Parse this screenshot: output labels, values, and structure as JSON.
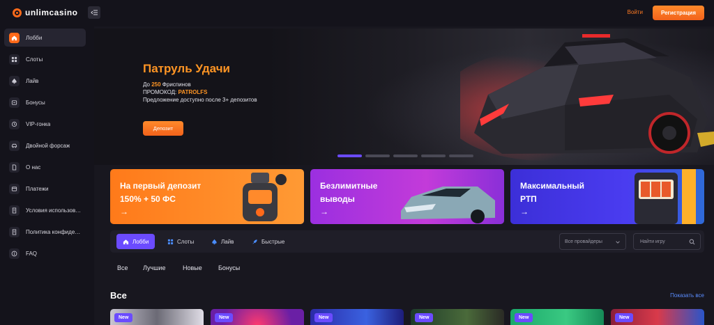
{
  "brand": {
    "name": "unlimcasino"
  },
  "header": {
    "login_label": "Войти",
    "register_label": "Регистрация"
  },
  "sidebar": {
    "items": [
      {
        "label": "Лобби",
        "icon": "home-icon"
      },
      {
        "label": "Слоты",
        "icon": "slots-grid-icon"
      },
      {
        "label": "Лайв",
        "icon": "live-spade-icon"
      },
      {
        "label": "Бонусы",
        "icon": "bonus-icon"
      },
      {
        "label": "VIP-гонка",
        "icon": "vip-race-icon"
      },
      {
        "label": "Двойной форсаж",
        "icon": "car-icon"
      },
      {
        "label": "О нас",
        "icon": "about-document-icon"
      },
      {
        "label": "Платежи",
        "icon": "payments-icon"
      },
      {
        "label": "Условия использова...",
        "icon": "terms-document-icon"
      },
      {
        "label": "Политика конфиден...",
        "icon": "privacy-document-icon"
      },
      {
        "label": "FAQ",
        "icon": "info-icon"
      }
    ]
  },
  "hero": {
    "title": "Патруль Удачи",
    "line1_prefix": "До",
    "line1_highlight": "250",
    "line1_suffix": "Фриспинов",
    "line2_prefix": "ПРОМОКОД:",
    "line2_highlight": "PATROLFS",
    "line3": "Предложение доступно после 3+ депозитов",
    "button_label": "Депозит",
    "slide_count": 5,
    "active_slide": 1
  },
  "promos": [
    {
      "title": "На первый депозит\n150% + 50 ФС",
      "arrow": "→"
    },
    {
      "title": "Безлимитные\nвыводы",
      "arrow": "→"
    },
    {
      "title": "Максимальный\nРТП",
      "arrow": "→"
    }
  ],
  "game_tabs": {
    "tabs": [
      {
        "label": "Лобби",
        "icon": "home-icon"
      },
      {
        "label": "Слоты",
        "icon": "slots-grid-icon"
      },
      {
        "label": "Лайв",
        "icon": "live-spade-icon"
      },
      {
        "label": "Быстрые",
        "icon": "rocket-icon"
      }
    ],
    "provider_placeholder": "Все провайдеры",
    "search_placeholder": "Найти игру"
  },
  "filters": [
    "Все",
    "Лучшие",
    "Новые",
    "Бонусы"
  ],
  "section": {
    "title": "Все",
    "show_all_label": "Показать все"
  },
  "games": [
    {
      "badge": "New"
    },
    {
      "badge": "New"
    },
    {
      "badge": "New"
    },
    {
      "badge": "New"
    },
    {
      "badge": "New"
    },
    {
      "badge": "New"
    }
  ],
  "colors": {
    "accent_orange": "#ff6a1a",
    "accent_purple": "#6b4bff",
    "link_blue": "#5a8dff",
    "background": "#14131b"
  }
}
